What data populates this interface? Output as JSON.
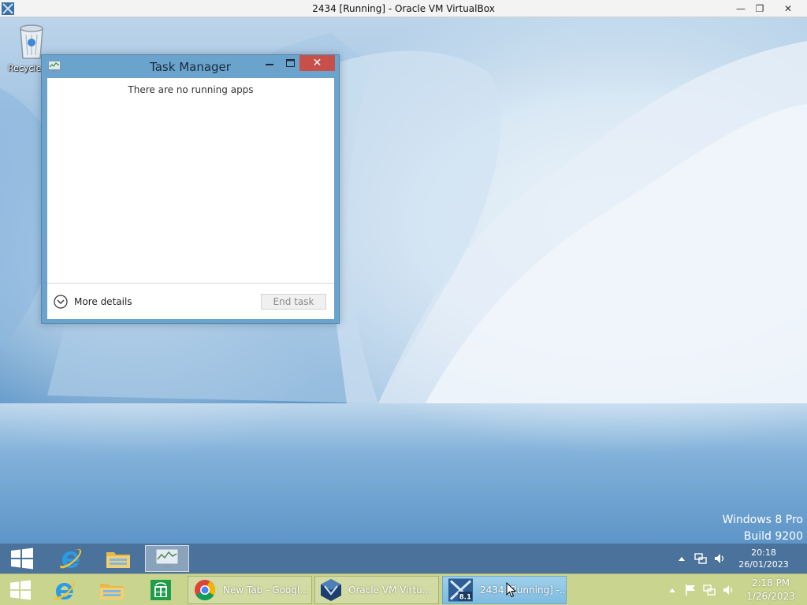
{
  "host_window": {
    "title": "2434 [Running] - Oracle VM VirtualBox",
    "minimize_glyph": "—",
    "restore_glyph": "❐",
    "close_glyph": "✕"
  },
  "desktop": {
    "recycle_bin_label": "Recycle",
    "watermark": {
      "line1": "Windows 8 Pro",
      "line2": "Build 9200"
    }
  },
  "task_manager": {
    "title": "Task Manager",
    "close_glyph": "✕",
    "empty_message": "There are no running apps",
    "more_details_label": "More details",
    "end_task_label": "End task",
    "end_task_enabled": false
  },
  "guest_taskbar": {
    "pinned": [
      {
        "name": "start",
        "icon": "windows-logo-icon"
      },
      {
        "name": "internet-explorer",
        "icon": "internet-explorer-icon"
      },
      {
        "name": "file-explorer",
        "icon": "folder-icon"
      },
      {
        "name": "task-manager",
        "icon": "task-manager-icon",
        "active": true
      }
    ],
    "clock": {
      "time": "20:18",
      "date": "26/01/2023"
    }
  },
  "host_taskbar": {
    "pinned": [
      {
        "name": "start",
        "icon": "windows-logo-icon"
      },
      {
        "name": "internet-explorer",
        "icon": "internet-explorer-icon"
      },
      {
        "name": "file-explorer",
        "icon": "folder-icon"
      },
      {
        "name": "store",
        "icon": "store-icon"
      }
    ],
    "buttons": [
      {
        "label": "New Tab - Googl...",
        "icon": "chrome-icon"
      },
      {
        "label": "Oracle VM Virtu...",
        "icon": "virtualbox-icon"
      },
      {
        "label": "2434 [Running] -...",
        "icon": "virtualbox-vm-icon",
        "badge": "8.1",
        "active": true
      }
    ],
    "clock": {
      "time": "2:18 PM",
      "date": "1/26/2023"
    }
  },
  "colors": {
    "host_taskbar": "#c9d48f",
    "guest_taskbar": "#466e96",
    "task_manager_frame": "#6aa4cc",
    "close_red": "#c7504a"
  }
}
